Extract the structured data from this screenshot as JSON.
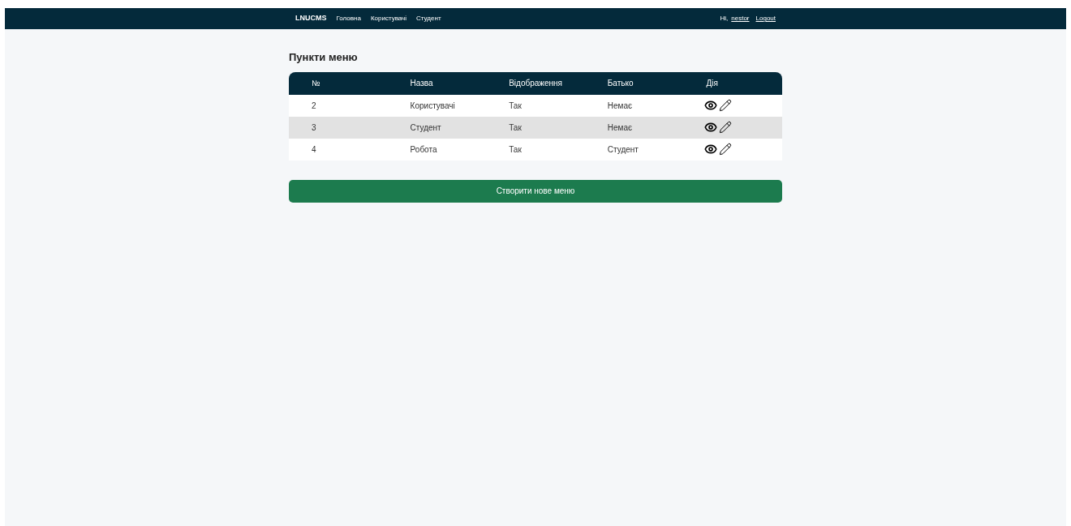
{
  "navbar": {
    "brand": "LNUCMS",
    "links": [
      "Головна",
      "Користувачі",
      "Студент"
    ],
    "greeting": "Hi,",
    "user": "nestor",
    "logout": "Logout"
  },
  "title": "Пункти меню",
  "table": {
    "columns": [
      "№",
      "Назва",
      "Відображення",
      "Батько",
      "Дія"
    ],
    "rows": [
      {
        "cells": [
          "2",
          "Користувачі",
          "Так",
          "Немає"
        ]
      },
      {
        "cells": [
          "3",
          "Студент",
          "Так",
          "Немає"
        ]
      },
      {
        "cells": [
          "4",
          "Робота",
          "Так",
          "Студент"
        ]
      }
    ]
  },
  "create_button": "Створити нове меню"
}
